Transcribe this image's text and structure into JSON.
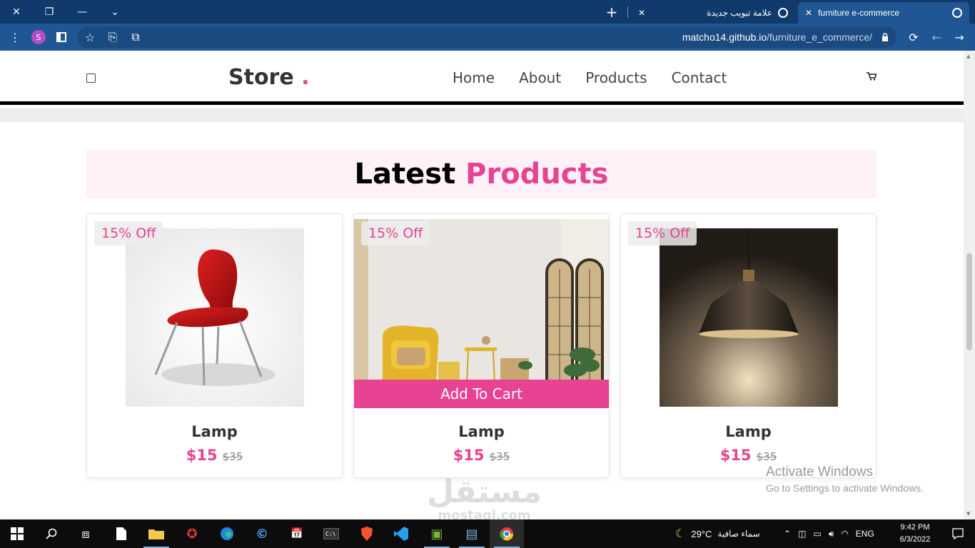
{
  "browser": {
    "tabs": [
      {
        "label": "furniture e-commerce",
        "active": true
      },
      {
        "label": "علامة تبويب جديدة",
        "active": false
      }
    ],
    "url_host": "matcho14.github.io",
    "url_path": "/furniture_e_commerce/",
    "profile_initial": "S",
    "icons": [
      "close-icon",
      "restore-icon",
      "minimize-icon",
      "chevron-down-icon",
      "new-tab-icon",
      "refresh-icon",
      "back-icon",
      "forward-icon",
      "menu-dots-icon",
      "sidebar-icon",
      "favorite-star-icon",
      "collections-icon",
      "read-aloud-icon",
      "lock-icon"
    ]
  },
  "site": {
    "logo": "Store",
    "logo_dot": ".",
    "nav": [
      "Home",
      "About",
      "Products",
      "Contact"
    ],
    "section_title_main": "Latest",
    "section_title_accent": "Products",
    "products": [
      {
        "badge": "15% Off",
        "name": "Lamp",
        "price": "$15",
        "old_price": "$35",
        "image": "red-chair"
      },
      {
        "badge": "15% Off",
        "name": "Lamp",
        "price": "$15",
        "old_price": "$35",
        "image": "living-room",
        "cart_label": "Add To Cart"
      },
      {
        "badge": "15% Off",
        "name": "Lamp",
        "price": "$15",
        "old_price": "$35",
        "image": "pendant-lamp"
      }
    ],
    "accent_color": "#e84393"
  },
  "overlay": {
    "activate_title": "Activate Windows",
    "activate_sub": "Go to Settings to activate Windows.",
    "watermark_ar": "مستقل",
    "watermark_en": "mostaql.com"
  },
  "taskbar": {
    "weather_temp": "29°C",
    "weather_desc": "سماء صافية",
    "lang": "ENG",
    "time": "9:42 PM",
    "date": "6/3/2022"
  }
}
